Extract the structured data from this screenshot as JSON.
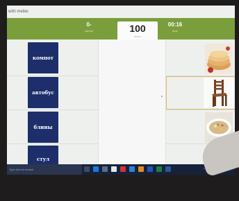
{
  "window": {
    "title": "with mebie"
  },
  "stats": {
    "correct_value": "0-",
    "correct_label": "correct",
    "score_value": "100",
    "score_label": "score",
    "time_value": "00:16",
    "time_label": "time"
  },
  "words": [
    "компот",
    "автобус",
    "блины",
    "стул"
  ],
  "images": [
    {
      "name": "pancakes-image",
      "icon": "pancakes"
    },
    {
      "name": "chair-image",
      "icon": "chair"
    },
    {
      "name": "soup-image",
      "icon": "soup"
    }
  ],
  "taskbar": {
    "search_placeholder": "Type here to search",
    "tray_text": "^ ⊕ ⊖ ⊙"
  },
  "colors": {
    "header": "#7a9e3b",
    "card": "#1d2e6a",
    "taskbar": "#16223a",
    "highlight": "#e3b66a"
  }
}
